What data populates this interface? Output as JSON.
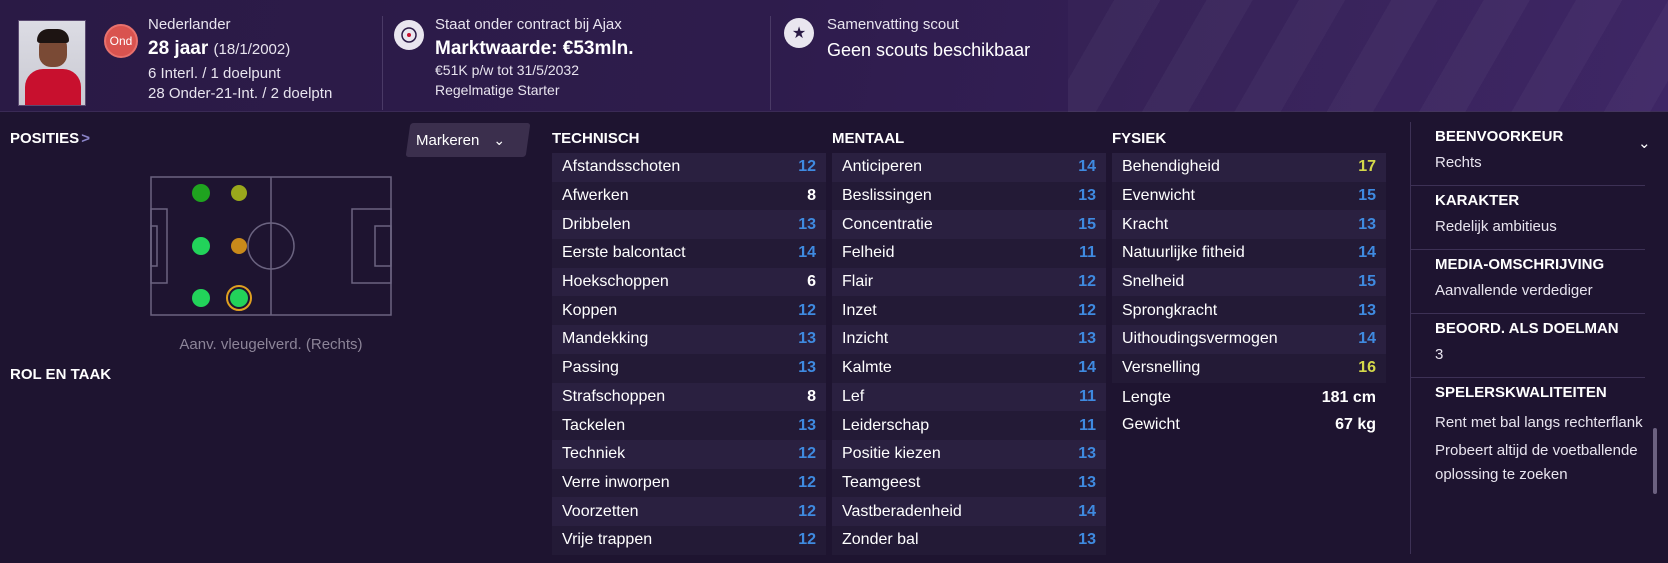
{
  "header": {
    "badge": "Ond",
    "nationality": "Nederlander",
    "age": "28 jaar",
    "birthdate": "(18/1/2002)",
    "caps": "6 Interl. / 1 doelpunt",
    "u21": "28 Onder-21-Int. / 2 doelptn",
    "contract": "Staat onder contract bij Ajax",
    "market_value": "Marktwaarde: €53mln.",
    "wage": "€51K p/w tot 31/5/2032",
    "status": "Regelmatige Starter",
    "scout_title": "Samenvatting scout",
    "scout_value": "Geen scouts beschikbaar",
    "icons": [
      "player-photo",
      "ajax-crest-icon",
      "star-icon"
    ]
  },
  "positions": {
    "title": "Posities",
    "title_arrow": ">",
    "markeren": "Markeren",
    "position_label": "Aanv. vleugelverd. (Rechts)",
    "role_title": "ROL EN TAAK",
    "dots": [
      {
        "id": "dm-left",
        "color": "#1fa31f"
      },
      {
        "id": "dm-right",
        "color": "#9aa81c"
      },
      {
        "id": "mid-left",
        "color": "#22d35a"
      },
      {
        "id": "mid-right",
        "color": "#c98a1a"
      },
      {
        "id": "def-left",
        "color": "#22d35a"
      },
      {
        "id": "def-right",
        "color": "#22d35a"
      }
    ]
  },
  "technisch": {
    "title": "TECHNISCH",
    "attributes": [
      {
        "name": "Afstandsschoten",
        "value": "12",
        "tone": "blue"
      },
      {
        "name": "Afwerken",
        "value": "8",
        "tone": "white"
      },
      {
        "name": "Dribbelen",
        "value": "13",
        "tone": "blue"
      },
      {
        "name": "Eerste balcontact",
        "value": "14",
        "tone": "blue"
      },
      {
        "name": "Hoekschoppen",
        "value": "6",
        "tone": "white"
      },
      {
        "name": "Koppen",
        "value": "12",
        "tone": "blue"
      },
      {
        "name": "Mandekking",
        "value": "13",
        "tone": "blue"
      },
      {
        "name": "Passing",
        "value": "13",
        "tone": "blue"
      },
      {
        "name": "Strafschoppen",
        "value": "8",
        "tone": "white"
      },
      {
        "name": "Tackelen",
        "value": "13",
        "tone": "blue"
      },
      {
        "name": "Techniek",
        "value": "12",
        "tone": "blue"
      },
      {
        "name": "Verre inworpen",
        "value": "12",
        "tone": "blue"
      },
      {
        "name": "Voorzetten",
        "value": "12",
        "tone": "blue"
      },
      {
        "name": "Vrije trappen",
        "value": "12",
        "tone": "blue"
      }
    ]
  },
  "mentaal": {
    "title": "MENTAAL",
    "attributes": [
      {
        "name": "Anticiperen",
        "value": "14",
        "tone": "blue"
      },
      {
        "name": "Beslissingen",
        "value": "13",
        "tone": "blue"
      },
      {
        "name": "Concentratie",
        "value": "15",
        "tone": "blue"
      },
      {
        "name": "Felheid",
        "value": "11",
        "tone": "blue"
      },
      {
        "name": "Flair",
        "value": "12",
        "tone": "blue"
      },
      {
        "name": "Inzet",
        "value": "12",
        "tone": "blue"
      },
      {
        "name": "Inzicht",
        "value": "13",
        "tone": "blue"
      },
      {
        "name": "Kalmte",
        "value": "14",
        "tone": "blue"
      },
      {
        "name": "Lef",
        "value": "11",
        "tone": "blue"
      },
      {
        "name": "Leiderschap",
        "value": "11",
        "tone": "blue"
      },
      {
        "name": "Positie kiezen",
        "value": "13",
        "tone": "blue"
      },
      {
        "name": "Teamgeest",
        "value": "13",
        "tone": "blue"
      },
      {
        "name": "Vastberadenheid",
        "value": "14",
        "tone": "blue"
      },
      {
        "name": "Zonder bal",
        "value": "13",
        "tone": "blue"
      }
    ]
  },
  "fysiek": {
    "title": "FYSIEK",
    "attributes": [
      {
        "name": "Behendigheid",
        "value": "17",
        "tone": "yellow"
      },
      {
        "name": "Evenwicht",
        "value": "15",
        "tone": "blue"
      },
      {
        "name": "Kracht",
        "value": "13",
        "tone": "blue"
      },
      {
        "name": "Natuurlijke fitheid",
        "value": "14",
        "tone": "blue"
      },
      {
        "name": "Snelheid",
        "value": "15",
        "tone": "blue"
      },
      {
        "name": "Sprongkracht",
        "value": "13",
        "tone": "blue"
      },
      {
        "name": "Uithoudingsvermogen",
        "value": "14",
        "tone": "blue"
      },
      {
        "name": "Versnelling",
        "value": "16",
        "tone": "yellow"
      }
    ],
    "height_label": "Lengte",
    "height_value": "181 cm",
    "weight_label": "Gewicht",
    "weight_value": "67 kg"
  },
  "info": {
    "foot_title": "BEENVOORKEUR",
    "foot_value": "Rechts",
    "character_title": "KARAKTER",
    "character_value": "Redelijk ambitieus",
    "media_title": "MEDIA-OMSCHRIJVING",
    "media_value": "Aanvallende verdediger",
    "gk_title": "BEOORD. ALS DOELMAN",
    "gk_value": "3",
    "traits_title": "SPELERSKWALITEITEN",
    "traits": [
      "Rent met bal langs rechterflank",
      "Probeert altijd de voetballende oplossing te zoeken"
    ],
    "chevron": "⌄"
  },
  "colors": {
    "blue": "#3f8ae0",
    "white": "#ffffff",
    "yellow": "#d4d84a"
  }
}
